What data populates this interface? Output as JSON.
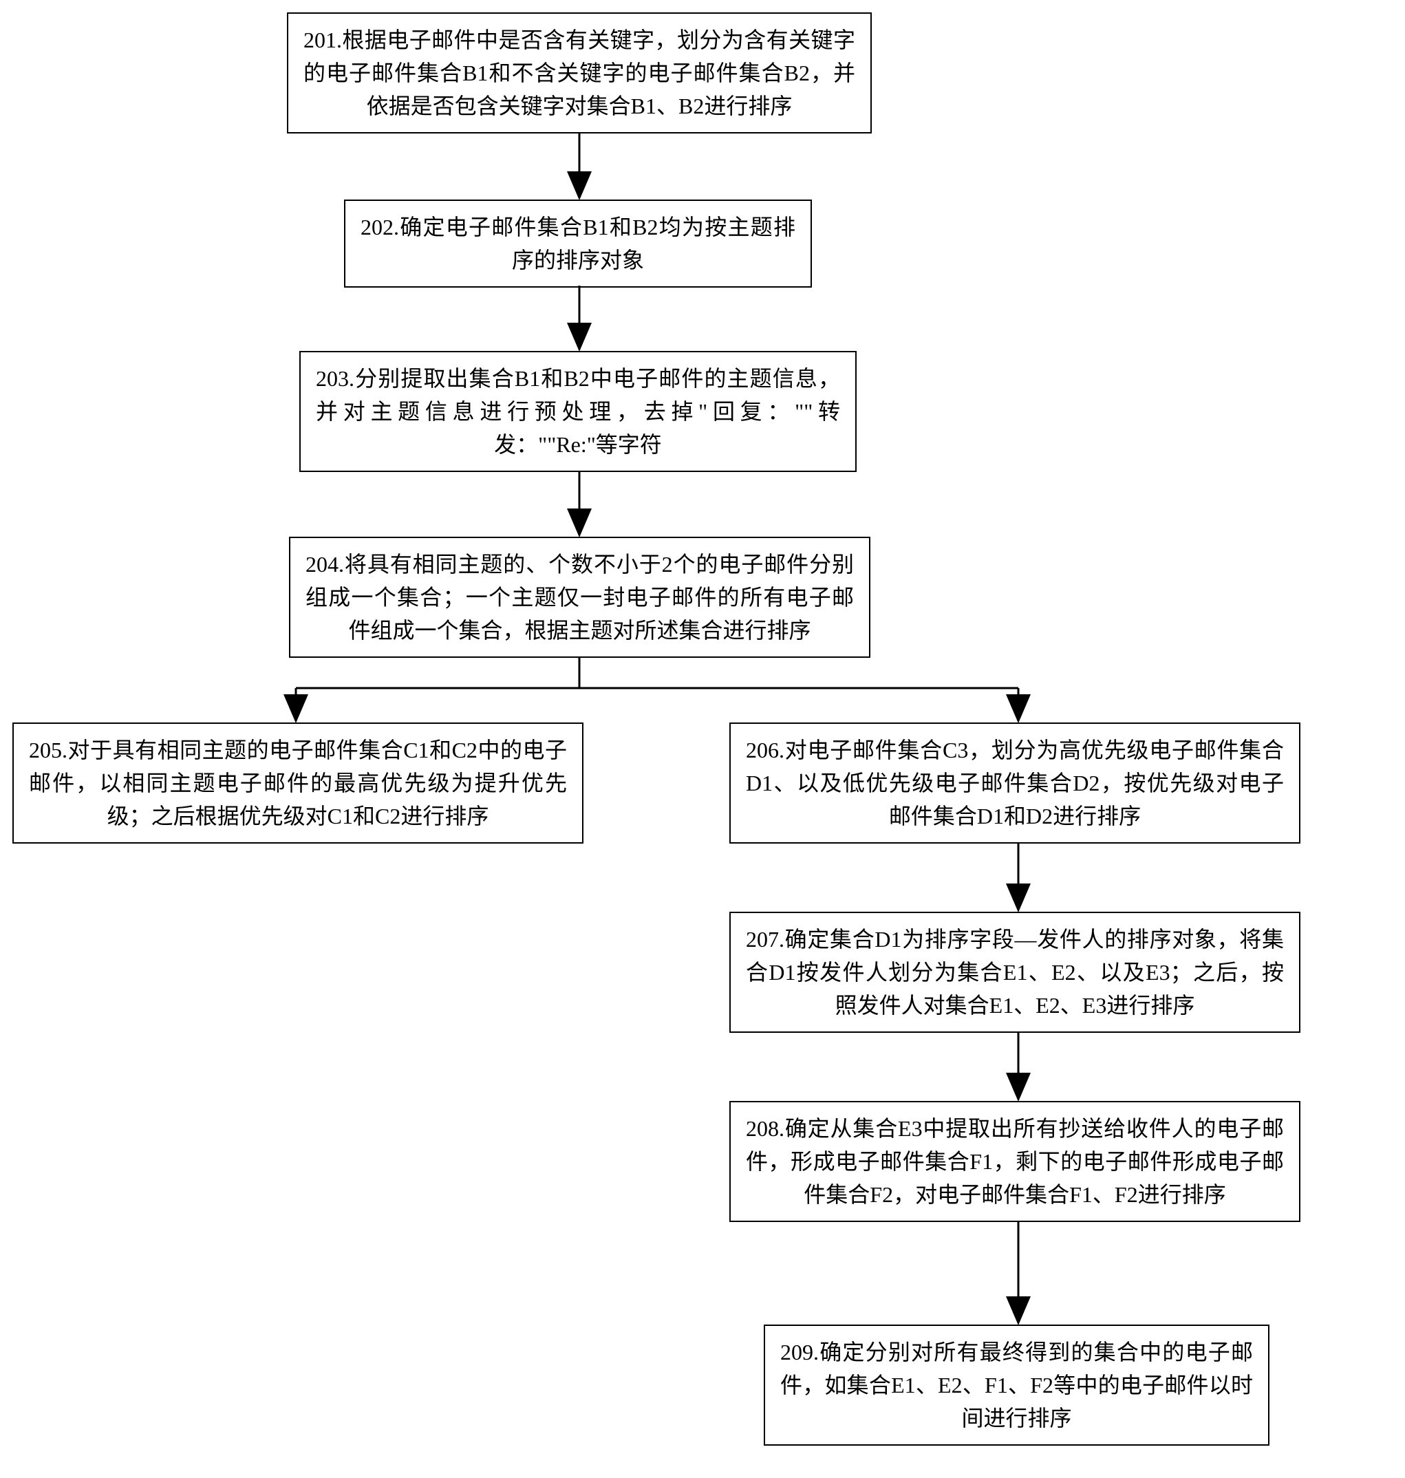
{
  "boxes": {
    "b201": "201.根据电子邮件中是否含有关键字，划分为含有关键字的电子邮件集合B1和不含关键字的电子邮件集合B2，并依据是否包含关键字对集合B1、B2进行排序",
    "b202": "202.确定电子邮件集合B1和B2均为按主题排序的排序对象",
    "b203": "203.分别提取出集合B1和B2中电子邮件的主题信息，并对主题信息进行预处理，去掉\"回复：\"\"转发：\"\"Re:\"等字符",
    "b204": "204.将具有相同主题的、个数不小于2个的电子邮件分别组成一个集合；一个主题仅一封电子邮件的所有电子邮件组成一个集合，根据主题对所述集合进行排序",
    "b205": "205.对于具有相同主题的电子邮件集合C1和C2中的电子邮件，以相同主题电子邮件的最高优先级为提升优先级；之后根据优先级对C1和C2进行排序",
    "b206": "206.对电子邮件集合C3，划分为高优先级电子邮件集合D1、以及低优先级电子邮件集合D2，按优先级对电子邮件集合D1和D2进行排序",
    "b207": "207.确定集合D1为排序字段—发件人的排序对象，将集合D1按发件人划分为集合E1、E2、以及E3；之后，按照发件人对集合E1、E2、E3进行排序",
    "b208": "208.确定从集合E3中提取出所有抄送给收件人的电子邮件，形成电子邮件集合F1，剩下的电子邮件形成电子邮件集合F2，对电子邮件集合F1、F2进行排序",
    "b209": "209.确定分别对所有最终得到的集合中的电子邮件，如集合E1、E2、F1、F2等中的电子邮件以时间进行排序"
  }
}
